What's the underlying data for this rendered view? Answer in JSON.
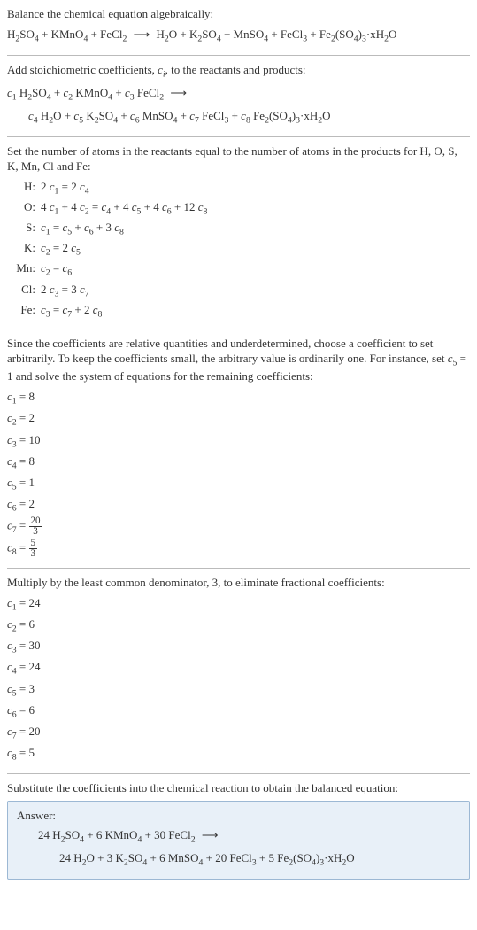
{
  "section1": {
    "title": "Balance the chemical equation algebraically:",
    "equation": "H₂SO₄ + KMnO₄ + FeCl₂ ⟶ H₂O + K₂SO₄ + MnSO₄ + FeCl₃ + Fe₂(SO₄)₃·xH₂O"
  },
  "section2": {
    "title_part1": "Add stoichiometric coefficients, ",
    "title_ci": "c",
    "title_i": "i",
    "title_part2": ", to the reactants and products:",
    "eq_line1_c1": "c₁",
    "eq_line1_r1": " H₂SO₄ + ",
    "eq_line1_c2": "c₂",
    "eq_line1_r2": " KMnO₄ + ",
    "eq_line1_c3": "c₃",
    "eq_line1_r3": " FeCl₂ ⟶",
    "eq_line2_c4": "c₄",
    "eq_line2_r4": " H₂O + ",
    "eq_line2_c5": "c₅",
    "eq_line2_r5": " K₂SO₄ + ",
    "eq_line2_c6": "c₆",
    "eq_line2_r6": " MnSO₄ + ",
    "eq_line2_c7": "c₇",
    "eq_line2_r7": " FeCl₃ + ",
    "eq_line2_c8": "c₈",
    "eq_line2_r8": " Fe₂(SO₄)₃·xH₂O"
  },
  "section3": {
    "title": "Set the number of atoms in the reactants equal to the number of atoms in the products for H, O, S, K, Mn, Cl and Fe:",
    "rows": [
      {
        "label": "H:",
        "eq": "2 c₁ = 2 c₄"
      },
      {
        "label": "O:",
        "eq": "4 c₁ + 4 c₂ = c₄ + 4 c₅ + 4 c₆ + 12 c₈"
      },
      {
        "label": "S:",
        "eq": "c₁ = c₅ + c₆ + 3 c₈"
      },
      {
        "label": "K:",
        "eq": "c₂ = 2 c₅"
      },
      {
        "label": "Mn:",
        "eq": "c₂ = c₆"
      },
      {
        "label": "Cl:",
        "eq": "2 c₃ = 3 c₇"
      },
      {
        "label": "Fe:",
        "eq": "c₃ = c₇ + 2 c₈"
      }
    ]
  },
  "section4": {
    "text_part1": "Since the coefficients are relative quantities and underdetermined, choose a coefficient to set arbitrarily. To keep the coefficients small, the arbitrary value is ordinarily one. For instance, set ",
    "c5": "c₅",
    "text_part2": " = 1 and solve the system of equations for the remaining coefficients:",
    "coeffs": [
      {
        "var": "c₁",
        "val": "8"
      },
      {
        "var": "c₂",
        "val": "2"
      },
      {
        "var": "c₃",
        "val": "10"
      },
      {
        "var": "c₄",
        "val": "8"
      },
      {
        "var": "c₅",
        "val": "1"
      },
      {
        "var": "c₆",
        "val": "2"
      }
    ],
    "c7_var": "c₇",
    "c7_num": "20",
    "c7_den": "3",
    "c8_var": "c₈",
    "c8_num": "5",
    "c8_den": "3"
  },
  "section5": {
    "title": "Multiply by the least common denominator, 3, to eliminate fractional coefficients:",
    "coeffs": [
      {
        "var": "c₁",
        "val": "24"
      },
      {
        "var": "c₂",
        "val": "6"
      },
      {
        "var": "c₃",
        "val": "30"
      },
      {
        "var": "c₄",
        "val": "24"
      },
      {
        "var": "c₅",
        "val": "3"
      },
      {
        "var": "c₆",
        "val": "6"
      },
      {
        "var": "c₇",
        "val": "20"
      },
      {
        "var": "c₈",
        "val": "5"
      }
    ]
  },
  "section6": {
    "title": "Substitute the coefficients into the chemical reaction to obtain the balanced equation:",
    "answer_label": "Answer:",
    "eq_line1": "24 H₂SO₄ + 6 KMnO₄ + 30 FeCl₂ ⟶",
    "eq_line2": "24 H₂O + 3 K₂SO₄ + 6 MnSO₄ + 20 FeCl₃ + 5 Fe₂(SO₄)₃·xH₂O"
  }
}
